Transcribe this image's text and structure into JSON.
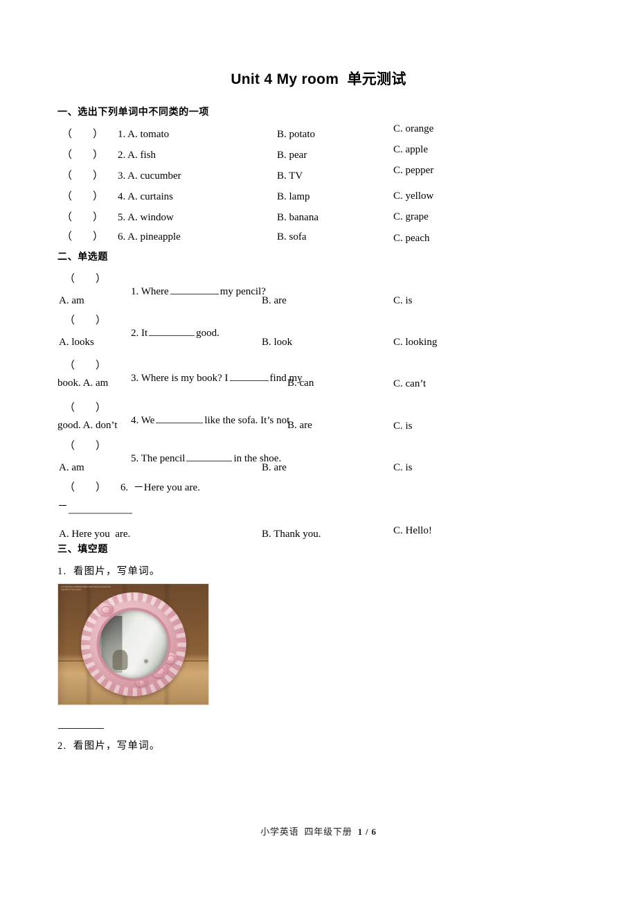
{
  "document": {
    "title": "Unit 4 My room  单元测试",
    "footer_subject": "小学英语  四年级下册",
    "footer_page": "1",
    "footer_separator": "/",
    "footer_total": "6"
  },
  "sections": [
    {
      "heading": "一、选出下列单词中不同类的一项",
      "questions": [
        {
          "bracket": "（        ）",
          "stem": "1. A. tomato",
          "b": "B. potato",
          "c": "C. orange"
        },
        {
          "bracket": "（        ）",
          "stem": "2. A. fish",
          "b": "B. pear",
          "c": "C. apple"
        },
        {
          "bracket": "（        ）",
          "stem": "3. A. cucumber",
          "b": "B. TV",
          "c": "C. pepper"
        },
        {
          "bracket": "（        ）",
          "stem": "4. A. curtains",
          "b": "B. lamp",
          "c": "C. yellow"
        },
        {
          "bracket": "（        ）",
          "stem": "5. A. window",
          "b": "B. banana",
          "c": "C. grape"
        },
        {
          "bracket": "（        ）",
          "stem": "6. A. pineapple",
          "b": "B. sofa",
          "c": "C. peach"
        }
      ]
    },
    {
      "heading": "二、单选题",
      "questions": [
        {
          "bracket": "（        ）",
          "stem_pre": "1. Where",
          "stem_post": "my pencil?",
          "a": "A. am",
          "b": "B. are",
          "c": "C. is"
        },
        {
          "bracket": "（        ）",
          "stem_pre": "2. It",
          "stem_post": "good.",
          "a": "A. looks",
          "b": "B. look",
          "c": "C. looking"
        },
        {
          "bracket": "（        ）",
          "stem_pre": "3. Where is my book? I",
          "stem_post": "find my",
          "a": "book. A. am",
          "b": "B. can",
          "c": "C. can’t"
        },
        {
          "bracket": "（        ）",
          "stem_pre": "4. We",
          "stem_post": "like the sofa. It’s not",
          "a": "good. A. don’t",
          "b": "B. are",
          "c": "C. is"
        },
        {
          "bracket": "（        ）",
          "stem_pre": "5. The pencil",
          "stem_post": "in the shoe.",
          "a": "A. am",
          "b": "B. are",
          "c": "C. is"
        },
        {
          "bracket": "（        ）",
          "stem_pre": "6.  －Here you are.",
          "stem_post": "",
          "dash": "－",
          "a": "A. Here you  are.",
          "b": "B. Thank you.",
          "c": "C. Hello!"
        }
      ]
    },
    {
      "heading": "三、填空题",
      "questions": [
        {
          "prompt": "1.  看图片，写单词。"
        },
        {
          "prompt": "2.  看图片，写单词。"
        }
      ]
    }
  ],
  "picture": {
    "alt_name": "pink-ornate-round-mirror",
    "watermark": "a small low-contrast watermark band across the top-left of the photo",
    "colors": {
      "frame": "#d69aa4",
      "rose": "#e3b2ba",
      "glass": "#eceeea",
      "wood": "#b98f5c"
    }
  }
}
